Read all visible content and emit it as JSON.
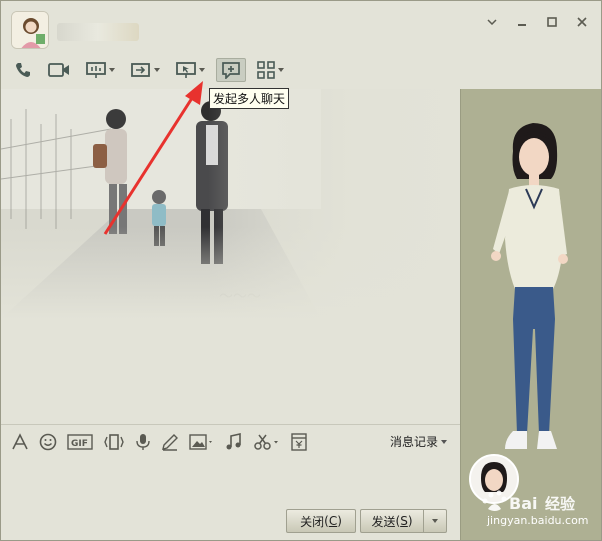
{
  "window": {
    "controls": {
      "menu_icon": "chevron-down-icon",
      "minimize_icon": "minimize-icon",
      "maximize_icon": "maximize-icon",
      "close_icon": "close-icon"
    }
  },
  "toolbar": {
    "buttons": [
      {
        "name": "voice-call-button",
        "icon": "phone-icon",
        "dropdown": false
      },
      {
        "name": "video-call-button",
        "icon": "video-camera-icon",
        "dropdown": false
      },
      {
        "name": "remote-demo-button",
        "icon": "presentation-icon",
        "dropdown": true
      },
      {
        "name": "send-file-button",
        "icon": "file-transfer-icon",
        "dropdown": true
      },
      {
        "name": "remote-desktop-button",
        "icon": "remote-desktop-icon",
        "dropdown": true
      },
      {
        "name": "create-group-chat-button",
        "icon": "multi-chat-icon",
        "dropdown": false,
        "active": true
      },
      {
        "name": "apps-button",
        "icon": "grid-icon",
        "dropdown": true
      }
    ],
    "tooltip": "发起多人聊天"
  },
  "input_toolbar": {
    "icons": [
      "font-icon",
      "emoji-icon",
      "gif-icon",
      "shake-icon",
      "voice-message-icon",
      "draw-icon",
      "image-icon",
      "music-icon",
      "screenshot-icon",
      "red-packet-icon"
    ],
    "history_label": "消息记录"
  },
  "actions": {
    "close_label": "关闭",
    "close_key": "C",
    "send_label": "发送",
    "send_key": "S"
  },
  "watermark": {
    "brand": "Bai",
    "brand_suffix": "经验",
    "url": "jingyan.baidu.com"
  },
  "colors": {
    "accent_arrow": "#e8322e",
    "panel_bg": "#aeb093",
    "window_bg": "#e3e3d8"
  }
}
